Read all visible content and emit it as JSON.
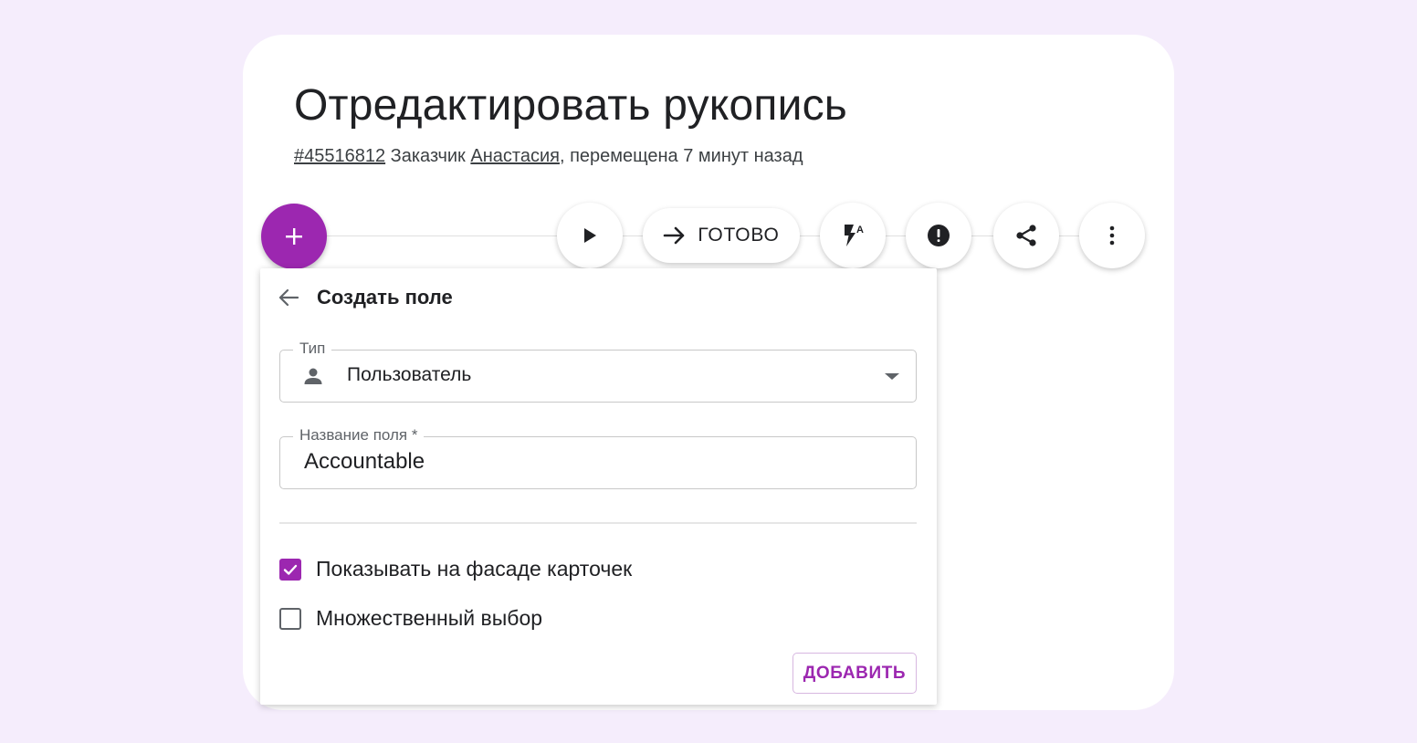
{
  "page": {
    "title": "Отредактировать рукопись",
    "meta": {
      "id_link": "#45516812",
      "customer_prefix": " Заказчик ",
      "customer_link": "Анастасия",
      "suffix": ", перемещена 7 минут назад"
    }
  },
  "toolbar": {
    "add_icon": "plus-icon",
    "play_icon": "play-icon",
    "done_label": "ГОТОВО",
    "done_icon": "arrow-right-icon",
    "automation_icon": "flash-auto-icon",
    "alert_icon": "exclamation-icon",
    "share_icon": "share-icon",
    "more_icon": "more-vertical-icon"
  },
  "panel": {
    "title": "Создать поле",
    "back_icon": "arrow-left-icon",
    "type_field": {
      "label": "Тип",
      "value": "Пользователь",
      "icon": "person-icon"
    },
    "name_field": {
      "label": "Название поля *",
      "value": "Accountable"
    },
    "options": [
      {
        "label": "Показывать на фасаде карточек",
        "checked": true
      },
      {
        "label": "Множественный выбор",
        "checked": false
      }
    ],
    "submit_label": "ДОБАВИТЬ"
  },
  "colors": {
    "accent": "#9c27b0",
    "background": "#f5edfc",
    "card": "#ffffff"
  }
}
